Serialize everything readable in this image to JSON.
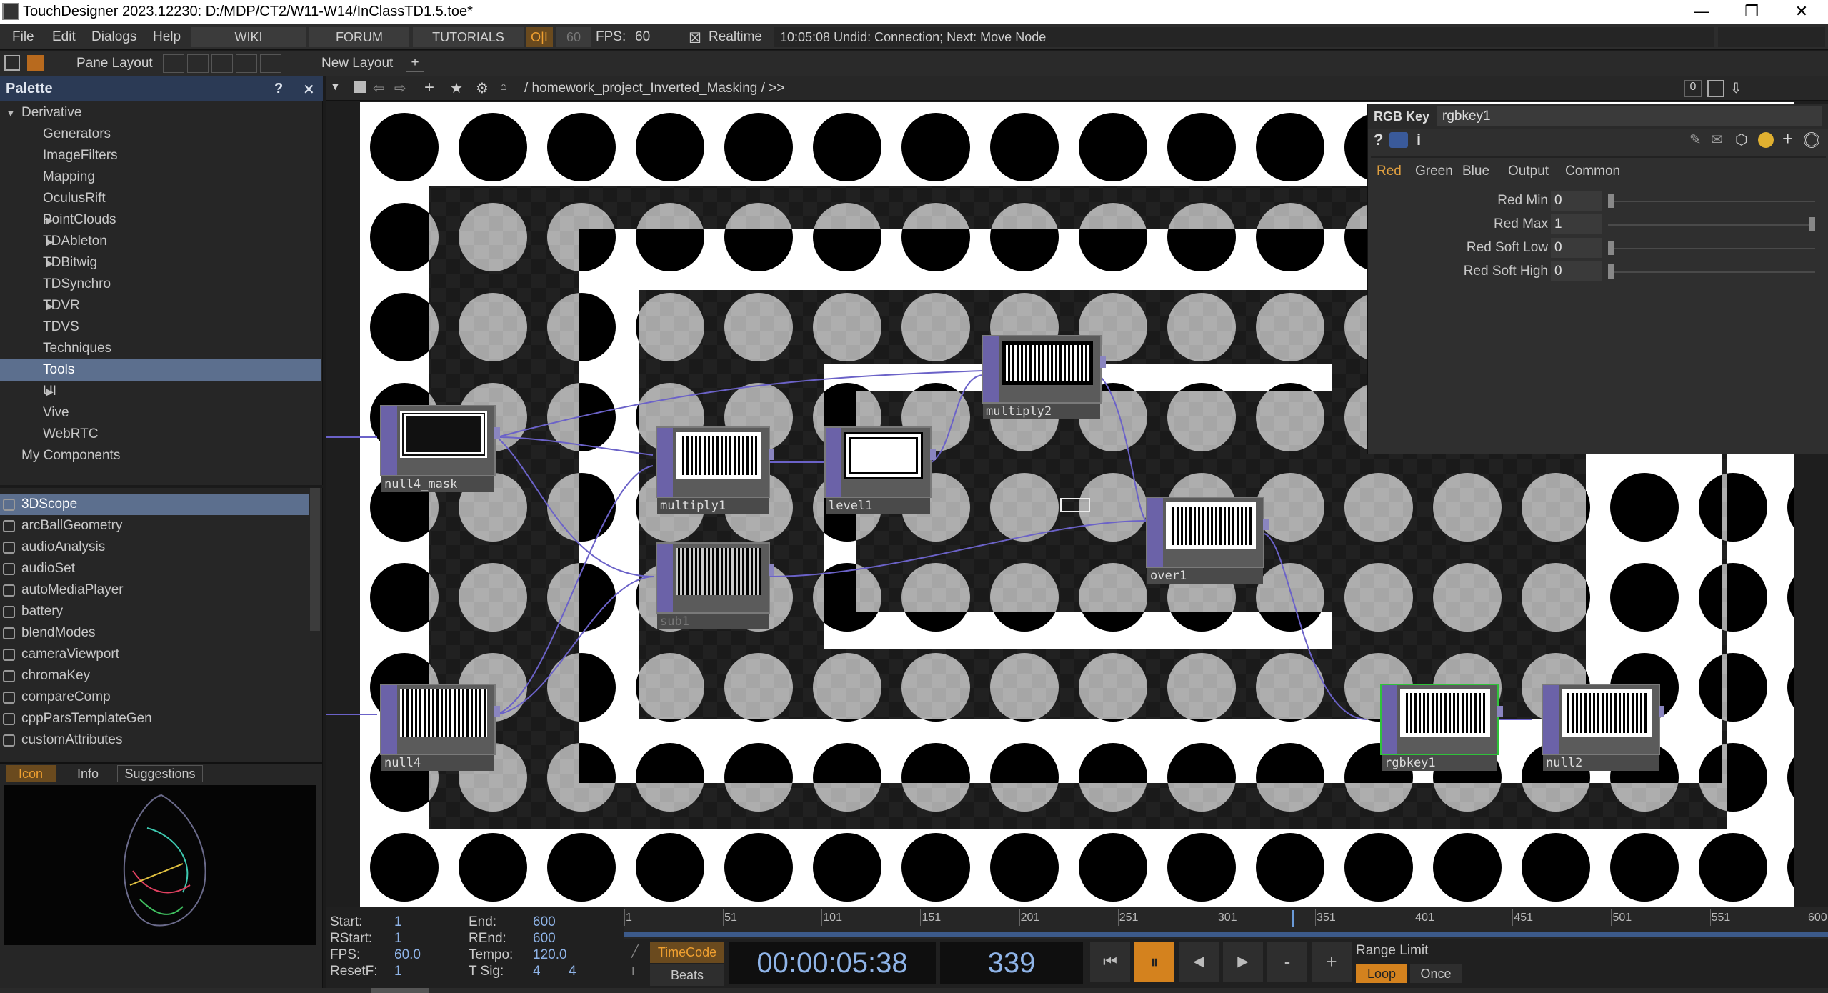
{
  "window": {
    "title": "TouchDesigner 2023.12230: D:/MDP/CT2/W11-W14/InClassTD1.5.toe*",
    "minimize": "—",
    "maximize": "❒",
    "close": "✕"
  },
  "menu": {
    "items": [
      "File",
      "Edit",
      "Dialogs",
      "Help"
    ],
    "wiki": "WIKI",
    "forum": "FORUM",
    "tutorials": "TUTORIALS",
    "oi": "O|I",
    "fps_cap": "60",
    "fps_label": "FPS:",
    "fps_value": "60",
    "realtime_check": "☒",
    "realtime": "Realtime",
    "status": "10:05:08 Undid: Connection; Next: Move Node"
  },
  "panebar": {
    "pane_layout": "Pane Layout",
    "new_layout": "New Layout",
    "add": "+"
  },
  "palette": {
    "title": "Palette",
    "help": "?",
    "close": "✕",
    "tree": [
      {
        "label": "Derivative",
        "indent": 0,
        "arrow": "▼"
      },
      {
        "label": "Generators",
        "indent": 2,
        "arrow": ""
      },
      {
        "label": "ImageFilters",
        "indent": 2,
        "arrow": ""
      },
      {
        "label": "Mapping",
        "indent": 2,
        "arrow": ""
      },
      {
        "label": "OculusRift",
        "indent": 2,
        "arrow": ""
      },
      {
        "label": "PointClouds",
        "indent": 2,
        "arrow": "▶"
      },
      {
        "label": "TDAbleton",
        "indent": 2,
        "arrow": "▶"
      },
      {
        "label": "TDBitwig",
        "indent": 2,
        "arrow": "▶"
      },
      {
        "label": "TDSynchro",
        "indent": 2,
        "arrow": ""
      },
      {
        "label": "TDVR",
        "indent": 2,
        "arrow": "▶"
      },
      {
        "label": "TDVS",
        "indent": 2,
        "arrow": ""
      },
      {
        "label": "Techniques",
        "indent": 2,
        "arrow": ""
      },
      {
        "label": "Tools",
        "indent": 2,
        "arrow": "",
        "selected": true
      },
      {
        "label": "UI",
        "indent": 2,
        "arrow": "▶"
      },
      {
        "label": "Vive",
        "indent": 2,
        "arrow": ""
      },
      {
        "label": "WebRTC",
        "indent": 2,
        "arrow": ""
      },
      {
        "label": "My Components",
        "indent": 1,
        "arrow": ""
      }
    ],
    "components": [
      {
        "label": "3DScope",
        "selected": true
      },
      {
        "label": "arcBallGeometry"
      },
      {
        "label": "audioAnalysis"
      },
      {
        "label": "audioSet"
      },
      {
        "label": "autoMediaPlayer"
      },
      {
        "label": "battery"
      },
      {
        "label": "blendModes"
      },
      {
        "label": "cameraViewport"
      },
      {
        "label": "chromaKey"
      },
      {
        "label": "compareComp"
      },
      {
        "label": "cppParsTemplateGen"
      },
      {
        "label": "customAttributes"
      }
    ],
    "tabs": {
      "icon": "Icon",
      "info": "Info",
      "suggestions": "Suggestions"
    }
  },
  "network": {
    "path": "/ homework_project_Inverted_Masking / >>",
    "count": "0",
    "nodes": [
      {
        "name": "null4_mask"
      },
      {
        "name": "multiply1"
      },
      {
        "name": "level1"
      },
      {
        "name": "multiply2"
      },
      {
        "name": "sub1"
      },
      {
        "name": "over1"
      },
      {
        "name": "null4"
      },
      {
        "name": "rgbkey1"
      },
      {
        "name": "null2"
      }
    ]
  },
  "params": {
    "op_type": "RGB Key",
    "op_name": "rgbkey1",
    "tabs": [
      "Red",
      "Green",
      "Blue",
      "Output",
      "Common"
    ],
    "rows": [
      {
        "label": "Red Min",
        "value": "0",
        "level": 0.0
      },
      {
        "label": "Red Max",
        "value": "1",
        "level": 1.0
      },
      {
        "label": "Red Soft Low",
        "value": "0",
        "level": 0.0
      },
      {
        "label": "Red Soft High",
        "value": "0",
        "level": 0.0
      }
    ]
  },
  "timeline": {
    "start_label": "Start:",
    "start": "1",
    "end_label": "End:",
    "end": "600",
    "rstart_label": "RStart:",
    "rstart": "1",
    "rend_label": "REnd:",
    "rend": "600",
    "fps_label": "FPS:",
    "fps": "60.0",
    "tempo_label": "Tempo:",
    "tempo": "120.0",
    "resetf_label": "ResetF:",
    "resetf": "1",
    "tsig_label": "T Sig:",
    "tsig_a": "4",
    "tsig_b": "4",
    "ticks": [
      "1",
      "51",
      "101",
      "151",
      "201",
      "251",
      "301",
      "351",
      "401",
      "451",
      "501",
      "551",
      "600"
    ],
    "playhead_frame": 339,
    "timecode_btn": "TimeCode",
    "beats_btn": "Beats",
    "timecode": "00:00:05:38",
    "frame": "339",
    "range_limit": "Range Limit",
    "loop": "Loop",
    "once": "Once",
    "minus": "-",
    "plus": "+"
  }
}
